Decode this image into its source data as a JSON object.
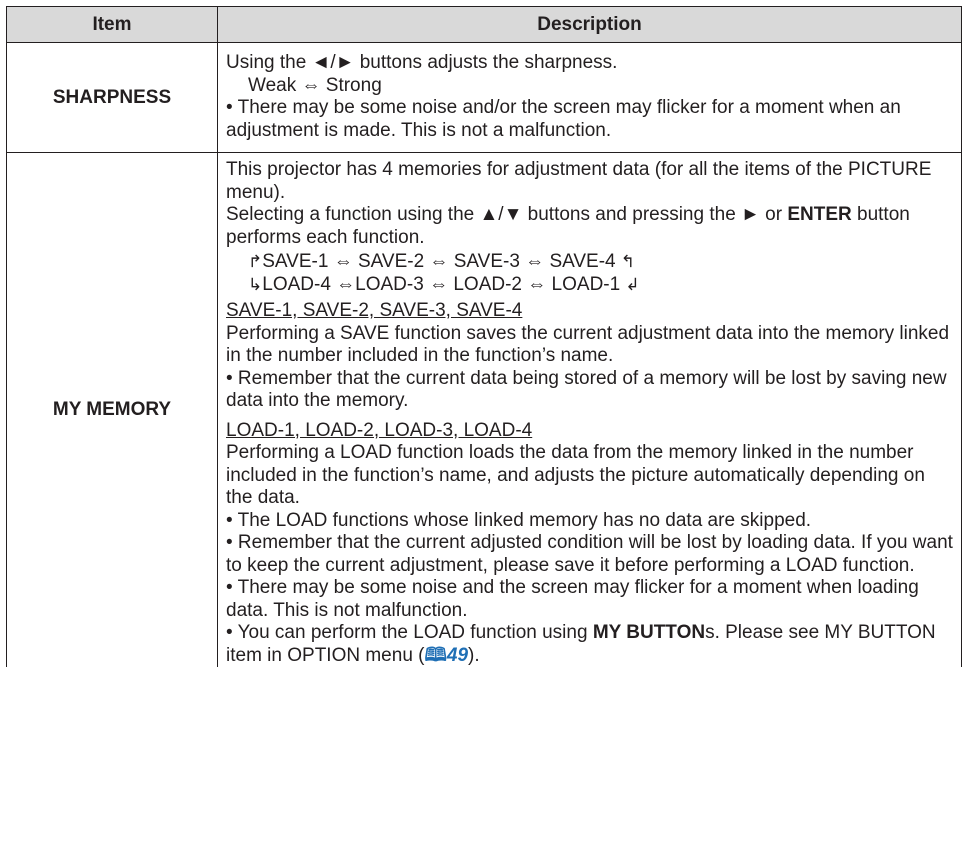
{
  "header": {
    "item": "Item",
    "description": "Description"
  },
  "sharpness": {
    "item": "SHARPNESS",
    "line1": "Using the ◄/► buttons adjusts the sharpness.",
    "scale": "Weak ⇔ Strong",
    "note": "• There may be some noise and/or the screen may flicker for a moment when an adjustment is made. This is not a malfunction."
  },
  "my_memory": {
    "item": "MY MEMORY",
    "intro": "This projector has 4 memories for adjustment data (for all the items of the PICTURE menu).",
    "select_pre": "Selecting a function using the ▲/▼ buttons and pressing the ► or ",
    "select_enter": "ENTER",
    "select_post": " button performs each function.",
    "cycle_row1": "SAVE-1 ⇔ SAVE-2 ⇔ SAVE-3 ⇔ SAVE-4",
    "cycle_row2": "LOAD-4 ⇔LOAD-3 ⇔ LOAD-2 ⇔ LOAD-1",
    "cycle_arrow_start_top": "↱",
    "cycle_arrow_start_bottom": "↳",
    "cycle_arrow_end_top": "↰",
    "cycle_arrow_end_bottom": "↲",
    "save_heading": "SAVE-1, SAVE-2, SAVE-3, SAVE-4",
    "save_text": "Performing a SAVE function saves the current adjustment data into the memory linked in the number included in the function’s name.",
    "save_note": "• Remember that the current data being stored of a memory will be lost by saving new data into the memory.",
    "load_heading": "LOAD-1, LOAD-2, LOAD-3, LOAD-4",
    "load_text": "Performing a LOAD function loads the data from the memory linked in the number included in the function’s name, and adjusts the picture automatically depending on the data.",
    "load_note1": "• The LOAD functions whose linked memory has no data are skipped.",
    "load_note2": "• Remember that the current adjusted condition will be lost by loading data. If you want to keep the current adjustment, please save it before performing a LOAD function.",
    "load_note3": "• There may be some noise and the screen may flicker for a moment when loading data. This is not malfunction.",
    "button_pre": "• You can perform the LOAD function using ",
    "button_bold": "MY BUTTON",
    "button_mid": "s. Please see MY BUTTON item in OPTION menu (",
    "ref_icon": "🕮",
    "ref_page": "49",
    "button_post": ")."
  }
}
